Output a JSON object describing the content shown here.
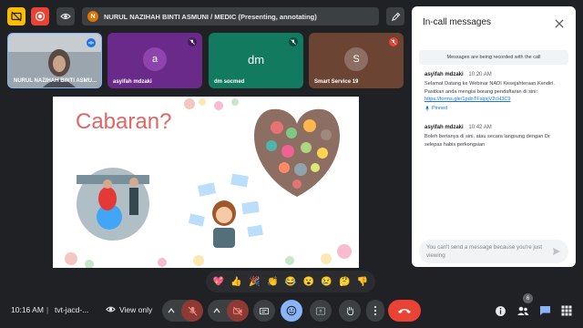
{
  "topbar": {
    "presenting_initial": "N",
    "presenting_text": "NURUL NAZIHAH BINTI ASMUNI / MEDIC (Presenting, annotating)"
  },
  "tiles": [
    {
      "name": "NURUL NAZIHAH BINTI ASMU...",
      "avatar": "",
      "color": "#6b7a8a"
    },
    {
      "name": "asyifah mdzaki",
      "avatar": "a",
      "color": "#6a2a8a"
    },
    {
      "name": "dm socmed",
      "avatar": "dm",
      "color": "#127a5e"
    },
    {
      "name": "Smart Service 19",
      "avatar": "S",
      "color": "#6b4434"
    }
  ],
  "slide": {
    "title": "Cabaran?"
  },
  "panel": {
    "title": "In-call messages",
    "notice": "Messages are being recorded with the call",
    "messages": [
      {
        "sender": "asyifah mdzaki",
        "time": "10:20 AM",
        "text": "Selamat Datang ke Webinar NADI Kesejahteraan Kendiri. Pastikan anda mengisi borang pendaftaran di sini: ",
        "link": "https://forms.gle/1pdoTFsqsjV2cH3C9",
        "pinned": "Pinned"
      },
      {
        "sender": "asyifah mdzaki",
        "time": "10:42 AM",
        "text": "Boleh bertanya di sini, atau secara langsung dengan Dr selepas habis perkongsian"
      }
    ],
    "input_placeholder": "You can't send a message because you're just viewing"
  },
  "reactions": [
    "💖",
    "👍",
    "🎉",
    "👏",
    "😂",
    "😮",
    "😢",
    "🤔",
    "👎"
  ],
  "bottombar": {
    "time": "10:16 AM",
    "divider": "|",
    "meeting_code": "tvt-jacd-...",
    "view_only": "View only",
    "participant_count": "6"
  },
  "colors": {
    "leave": "#ea4335",
    "active_blue": "#8ab4f8",
    "record_red": "#ea4335",
    "caption_yellow": "#fbbc04"
  }
}
